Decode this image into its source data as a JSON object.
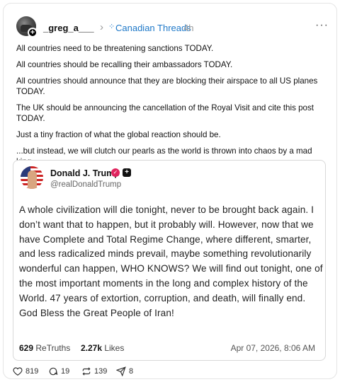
{
  "post": {
    "username": "_greg_a___",
    "separator": "›",
    "community_icon": "⁘",
    "community": "Canadian Threads",
    "time": "4h",
    "more": "···",
    "paragraphs": [
      "All countries need to be threatening sanctions TODAY.",
      "All countries should be recalling their ambassadors TODAY.",
      "All countries should announce that they are blocking their airspace to all US planes TODAY.",
      "The UK should be announcing the cancellation of the Royal Visit and cite this post TODAY.",
      "Just a tiny fraction of what the global reaction should be.",
      "...but instead, we will clutch our pearls as the world is thrown into chaos by a mad king."
    ]
  },
  "embed": {
    "name": "Donald J. Trump",
    "handle": "@realDonaldTrump",
    "text": "A whole civilization will die tonight, never to be brought back again. I don’t want that to happen, but it probably will. However, now that we have Complete and Total Regime Change, where different, smarter, and less radicalized minds prevail, maybe something revolutionarily wonderful can happen, WHO KNOWS? We will find out tonight, one of the most important moments in the long and complex history of the World. 47 years of extortion, corruption, and death, will finally end. God Bless the Great People of Iran!",
    "retruths_count": "629",
    "retruths_label": "ReTruths",
    "likes_count": "2.27k",
    "likes_label": "Likes",
    "date": "Apr 07, 2026, 8:06 AM"
  },
  "actions": {
    "likes": "819",
    "replies": "19",
    "reposts": "139",
    "shares": "8"
  },
  "colors": {
    "accent": "#1e78c8",
    "verified": "#e0245e"
  }
}
